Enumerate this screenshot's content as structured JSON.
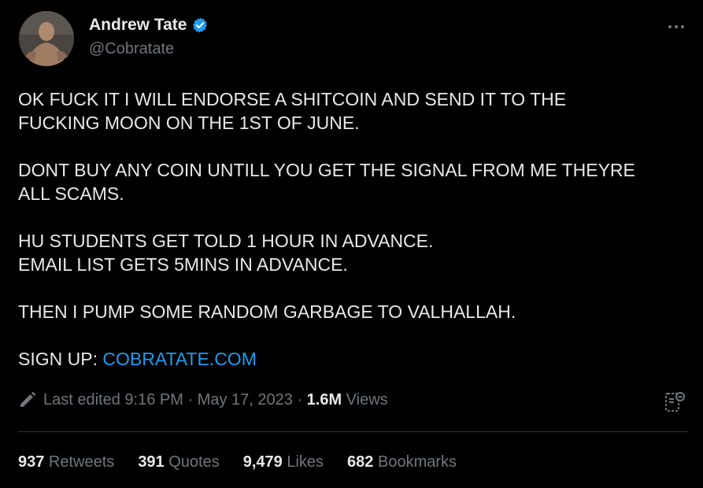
{
  "author": {
    "name": "Andrew Tate",
    "handle": "@Cobratate",
    "verified_icon": "verified-badge-icon"
  },
  "colors": {
    "background": "#000000",
    "text": "#e7e9ea",
    "muted": "#71767b",
    "link": "#1d9bf0",
    "divider": "#2f3336"
  },
  "tweet": {
    "line1": "OK FUCK IT I WILL ENDORSE A SHITCOIN AND SEND IT TO THE",
    "line2": "FUCKING MOON ON THE 1ST OF JUNE.",
    "line3": "DONT BUY ANY COIN UNTILL YOU GET THE SIGNAL FROM ME THEYRE",
    "line4": "ALL SCAMS.",
    "line5": "HU STUDENTS GET TOLD 1 HOUR IN ADVANCE.",
    "line6": "EMAIL LIST GETS 5MINS IN ADVANCE.",
    "line7": "THEN I PUMP SOME RANDOM GARBAGE TO VALHALLAH.",
    "signup_prefix": "SIGN UP: ",
    "signup_link": "COBRATATE.COM"
  },
  "meta": {
    "edited_label": "Last edited 9:16 PM",
    "separator": " · ",
    "date": "May 17, 2023",
    "views_count": "1.6M",
    "views_label": " Views"
  },
  "stats": [
    {
      "count": "937",
      "label": " Retweets"
    },
    {
      "count": "391",
      "label": " Quotes"
    },
    {
      "count": "9,479",
      "label": " Likes"
    },
    {
      "count": "682",
      "label": " Bookmarks"
    }
  ]
}
